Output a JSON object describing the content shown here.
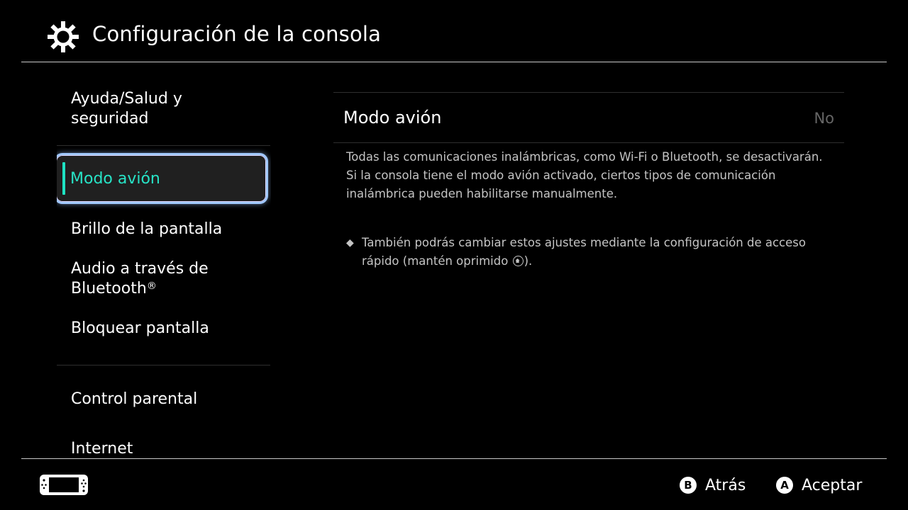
{
  "header": {
    "title": "Configuración de la consola",
    "icon": "gear-icon"
  },
  "sidebar": {
    "items": [
      {
        "label": "Ayuda/Salud y",
        "label2": "seguridad"
      },
      {
        "label": "Modo avión",
        "selected": true
      },
      {
        "label": "Brillo de la pantalla"
      },
      {
        "label": "Audio a través de",
        "label2": "Bluetooth",
        "mark": "®"
      },
      {
        "label": "Bloquear pantalla"
      },
      {
        "label": "Control parental"
      },
      {
        "label": "Internet"
      }
    ]
  },
  "detail": {
    "setting_name": "Modo avión",
    "setting_value": "No",
    "description_line1": "Todas las comunicaciones inalámbricas, como Wi-Fi o Bluetooth, se desactivarán.",
    "description_line2": "Si la consola tiene el modo avión activado, ciertos tipos de comunicación inalámbrica pueden habilitarse manualmente.",
    "note_bullet": "◆",
    "note_before": "También podrás cambiar estos ajustes mediante la configuración de acceso rápido (mantén oprimido ",
    "note_after": ")."
  },
  "footer": {
    "back_key": "B",
    "back_label": "Atrás",
    "accept_key": "A",
    "accept_label": "Aceptar"
  },
  "colors": {
    "accent": "#27e3c6",
    "highlight_border": "#9fc7ff",
    "text_dim": "#c4c4c4"
  }
}
